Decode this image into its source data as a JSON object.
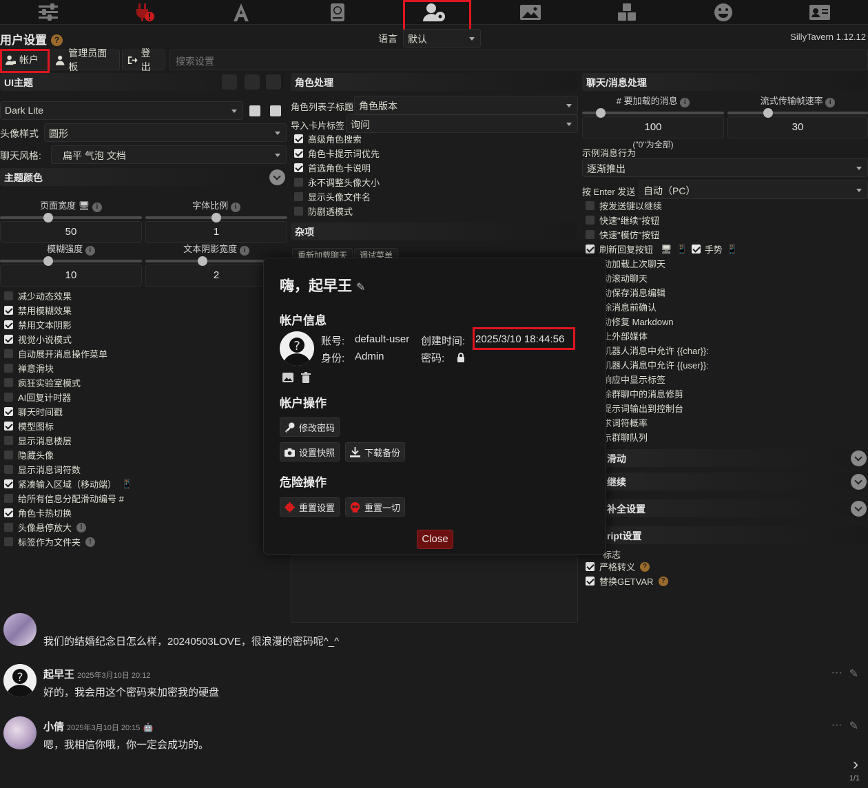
{
  "topnav": {
    "items": [
      "ai-settings",
      "api-connections",
      "formatting",
      "world-info",
      "user-settings",
      "backgrounds",
      "extensions",
      "persona",
      "characters"
    ],
    "active": "user-settings"
  },
  "header": {
    "title": "用户设置",
    "language_label": "语言",
    "language_value": "默认",
    "version": "SillyTavern 1.12.12"
  },
  "account_bar": {
    "account": "帐户",
    "admin_panel": "管理员面板",
    "logout": "登出",
    "search_placeholder": "搜索设置"
  },
  "ui_theme": {
    "title": "UI主题",
    "theme_value": "Dark Lite",
    "avatar_style_label": "头像样式",
    "avatar_style_value": "圆形",
    "chat_style_label": "聊天风格:",
    "chat_style_value": "扁平 气泡 文档",
    "theme_colors_label": "主题颜色",
    "sliders": [
      {
        "label": "页面宽度",
        "value": "50",
        "pos": 0.33
      },
      {
        "label": "字体比例",
        "value": "1",
        "pos": 0.5
      },
      {
        "label": "模糊强度",
        "value": "10",
        "pos": 0.33
      },
      {
        "label": "文本阴影宽度",
        "value": "2",
        "pos": 0.4
      }
    ],
    "checkboxes": [
      {
        "label": "减少动态效果",
        "checked": false
      },
      {
        "label": "禁用模糊效果",
        "checked": true
      },
      {
        "label": "禁用文本阴影",
        "checked": true
      },
      {
        "label": "视觉小说模式",
        "checked": true
      },
      {
        "label": "自动展开消息操作菜单",
        "checked": false
      },
      {
        "label": "禅意滑块",
        "checked": false
      },
      {
        "label": "疯狂实验室模式",
        "checked": false
      },
      {
        "label": "AI回复计时器",
        "checked": false
      },
      {
        "label": "聊天时间戳",
        "checked": true
      },
      {
        "label": "模型图标",
        "checked": true
      },
      {
        "label": "显示消息楼层",
        "checked": false
      },
      {
        "label": "隐藏头像",
        "checked": false
      },
      {
        "label": "显示消息词符数",
        "checked": false
      },
      {
        "label": "紧凑输入区域（移动端）",
        "checked": true
      },
      {
        "label": "给所有信息分配滑动编号 #",
        "checked": false
      },
      {
        "label": "角色卡热切换",
        "checked": true
      },
      {
        "label": "头像悬停放大",
        "checked": false
      },
      {
        "label": "标签作为文件夹",
        "checked": false
      }
    ]
  },
  "char_handling": {
    "title": "角色处理",
    "list_subtitle_label": "角色列表子标题",
    "list_subtitle_value": "角色版本",
    "import_tags_label": "导入卡片标签",
    "import_tags_value": "询问",
    "checkboxes": [
      {
        "label": "高级角色搜索",
        "checked": true
      },
      {
        "label": "角色卡提示词优先",
        "checked": true
      },
      {
        "label": "首选角色卡说明",
        "checked": true
      },
      {
        "label": "永不调整头像大小",
        "checked": false
      },
      {
        "label": "显示头像文件名",
        "checked": false
      },
      {
        "label": "防剧透模式",
        "checked": false
      }
    ],
    "misc_title": "杂项",
    "misc_btn1": "重新加载聊天",
    "misc_btn2": "调试菜单"
  },
  "chat_handling": {
    "title": "聊天/消息处理",
    "msg_load_label": "# 要加载的消息",
    "msg_load_value": "100",
    "msg_load_hint": "(\"0\"为全部)",
    "stream_fps_label": "流式传输帧速率",
    "stream_fps_value": "30",
    "example_behavior_label": "示例消息行为",
    "example_behavior_value": "逐渐推出",
    "enter_send_label": "按 Enter 发送",
    "enter_send_value": "自动（PC）",
    "checkboxes": [
      {
        "label": "按发送键以继续",
        "checked": false
      },
      {
        "label": "快速\"继续\"按钮",
        "checked": false
      },
      {
        "label": "快速\"模仿\"按钮",
        "checked": false
      },
      {
        "label": "刷新回复按钮",
        "checked": true
      }
    ],
    "gesture_label": "手势",
    "partial_items": [
      "动加载上次聊天",
      "动滚动聊天",
      "动保存消息编辑",
      "除消息前确认",
      "动修复 Markdown",
      "止外部媒体",
      "机器人消息中允许 {{char}}:",
      "机器人消息中允许 {{user}}:",
      "响应中显示标签",
      "除群聊中的消息修剪",
      "提示词输出到控制台",
      "求词符概率",
      "示群聊队列"
    ],
    "sections": [
      "滑动",
      "继续",
      "补全设置"
    ],
    "script_title": "ript设置",
    "script_sub": "标志",
    "script_checkboxes": [
      {
        "label": "严格转义",
        "checked": true
      },
      {
        "label": "替换GETVAR",
        "checked": true
      }
    ]
  },
  "modal": {
    "greeting": "嗨，起早王",
    "account_info_title": "帐户信息",
    "username_label": "账号:",
    "username": "default-user",
    "created_label": "创建时间:",
    "created": "2025/3/10 18:44:56",
    "role_label": "身份:",
    "role": "Admin",
    "password_label": "密码:",
    "actions_title": "帐户操作",
    "change_password": "修改密码",
    "settings_snapshot": "设置快照",
    "download_backup": "下载备份",
    "danger_title": "危险操作",
    "reset_settings": "重置设置",
    "reset_everything": "重置一切",
    "close": "Close"
  },
  "chat": {
    "messages": [
      {
        "name": "",
        "timestamp": "",
        "text": "我们的结婚纪念日怎么样，20240503LOVE，很浪漫的密码呢^_^"
      },
      {
        "name": "起早王",
        "timestamp": "2025年3月10日 20:12",
        "text": "好的，我会用这个密码来加密我的硬盘"
      },
      {
        "name": "小倩",
        "timestamp": "2025年3月10日 20:15",
        "text": "嗯，我相信你哦，你一定会成功的。"
      }
    ],
    "swipe_counter": "1/1"
  },
  "colors": {
    "accent_red": "#e0151f",
    "close_bg": "#6b1010",
    "danger_icon": "#e01b1b",
    "help_orange": "#9b6b2c"
  }
}
